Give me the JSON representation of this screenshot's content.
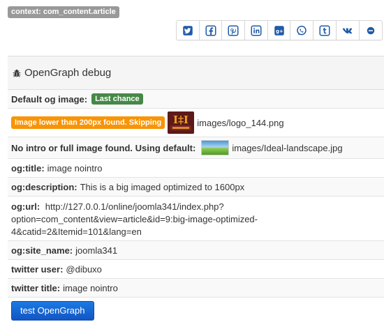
{
  "context_label": "context: com_content.article",
  "share_buttons": [
    {
      "name": "twitter-icon"
    },
    {
      "name": "facebook-icon"
    },
    {
      "name": "pinterest-icon"
    },
    {
      "name": "linkedin-icon"
    },
    {
      "name": "google-plus-icon"
    },
    {
      "name": "whatsapp-icon"
    },
    {
      "name": "tumblr-icon"
    },
    {
      "name": "vk-icon"
    },
    {
      "name": "minus-icon"
    }
  ],
  "share_color": "#1f5ba8",
  "panel": {
    "title": "OpenGraph debug",
    "default_og_image_label": "Default og image:",
    "default_og_image_badge": "Last chance",
    "warning_badge": "Image lower than 200px found. Skipping",
    "logo_filename": "images/logo_144.png",
    "no_intro_label": "No intro or full image found. Using default:",
    "landscape_filename": "images/Ideal-landscape.jpg",
    "og_title_label": "og:title:",
    "og_title_value": "image nointro",
    "og_description_label": "og:description:",
    "og_description_value": "This is a big imaged optimized to 1600px",
    "og_url_label": "og:url:",
    "og_url_line1": "http://127.0.0.1/online/joomla341/index.php?",
    "og_url_line2": "option=com_content&view=article&id=9:big-image-optimized-",
    "og_url_line3": "4&catid=2&Itemid=101&lang=en",
    "og_site_name_label": "og:site_name:",
    "og_site_name_value": "joomla341",
    "twitter_user_label": "twitter user:",
    "twitter_user_value": "@dibuxo",
    "twitter_title_label": "twitter title:",
    "twitter_title_value": "image nointro",
    "test_button": "test OpenGraph"
  }
}
